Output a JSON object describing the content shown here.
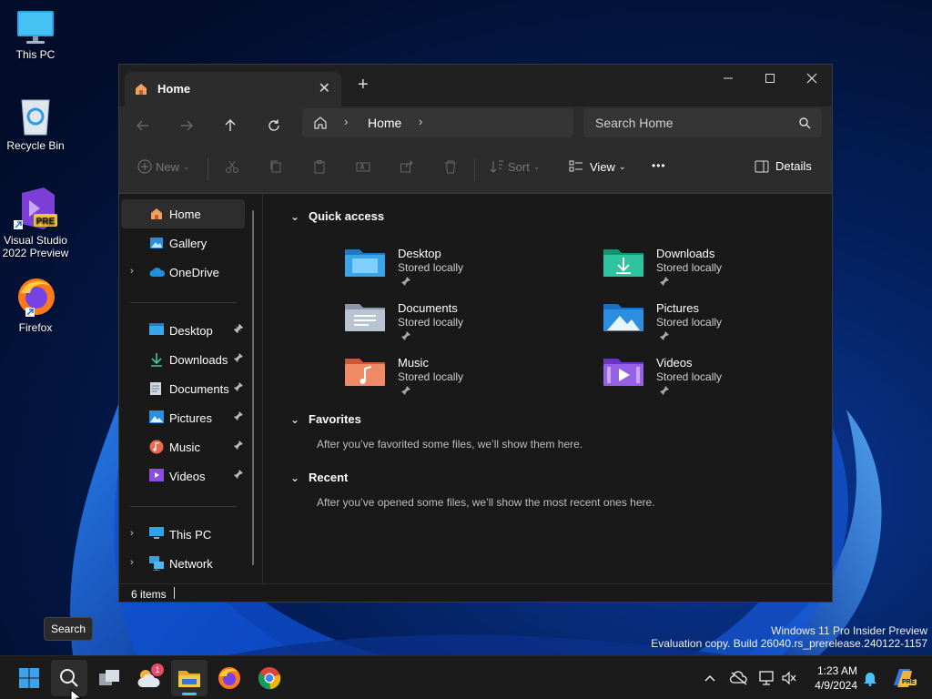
{
  "desktop": {
    "icons": [
      {
        "label": "This PC"
      },
      {
        "label": "Recycle Bin"
      },
      {
        "label": "Visual Studio\n2022 Preview"
      },
      {
        "label": "Firefox"
      }
    ],
    "watermark": {
      "line1": "Windows 11 Pro Insider Preview",
      "line2": "Evaluation copy. Build 26040.rs_prerelease.240122-1157"
    },
    "tooltip": "Search"
  },
  "explorer": {
    "tab_title": "Home",
    "new_tab_symbol": "+",
    "address_location": "Home",
    "search_placeholder": "Search Home",
    "toolbar": {
      "new_label": "New",
      "sort_label": "Sort",
      "view_label": "View",
      "more_label": "•••",
      "details_label": "Details"
    },
    "sidebar": {
      "home": "Home",
      "gallery": "Gallery",
      "onedrive": "OneDrive",
      "pinned": [
        "Desktop",
        "Downloads",
        "Documents",
        "Pictures",
        "Music",
        "Videos"
      ],
      "this_pc": "This PC",
      "network": "Network"
    },
    "sections": {
      "quick_access": "Quick access",
      "favorites": "Favorites",
      "favorites_empty": "After you’ve favorited some files, we’ll show them here.",
      "recent": "Recent",
      "recent_empty": "After you’ve opened some files, we’ll show the most recent ones here."
    },
    "quick_access_items": [
      {
        "name": "Desktop",
        "status": "Stored locally"
      },
      {
        "name": "Downloads",
        "status": "Stored locally"
      },
      {
        "name": "Documents",
        "status": "Stored locally"
      },
      {
        "name": "Pictures",
        "status": "Stored locally"
      },
      {
        "name": "Music",
        "status": "Stored locally"
      },
      {
        "name": "Videos",
        "status": "Stored locally"
      }
    ],
    "status_bar": "6 items"
  },
  "taskbar": {
    "widget_badge": "1",
    "clock_time": "1:23 AM",
    "clock_date": "4/9/2024",
    "pre_badge": "PRE"
  },
  "colors": {
    "wallpaper_dark": "#021238",
    "wallpaper_bloom": "#1a6fe0",
    "accent": "#4cc2ff"
  }
}
